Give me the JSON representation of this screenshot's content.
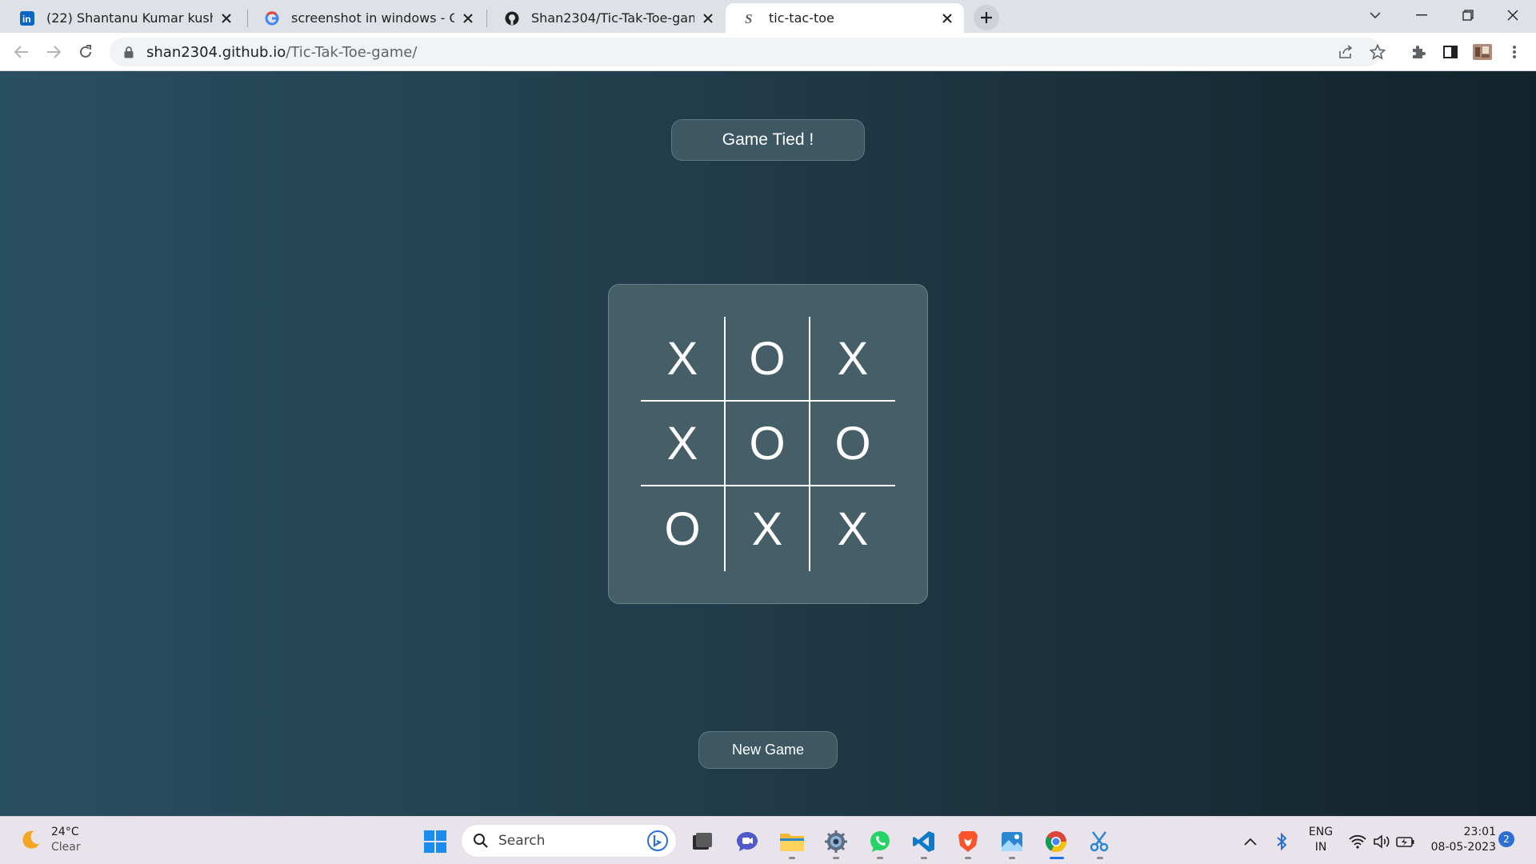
{
  "browser": {
    "tabs": [
      {
        "title": "(22) Shantanu Kumar kushwaha |",
        "icon": "linkedin-icon",
        "active": false
      },
      {
        "title": "screenshot in windows - Google",
        "icon": "google-icon",
        "active": false
      },
      {
        "title": "Shan2304/Tic-Tak-Toe-game: Tic",
        "icon": "github-icon",
        "active": false
      },
      {
        "title": "tic-tac-toe",
        "icon": "site-icon",
        "active": true
      }
    ],
    "url_host": "shan2304.github.io",
    "url_path": "/Tic-Tak-Toe-game/"
  },
  "game": {
    "status": "Game Tied !",
    "board": [
      "X",
      "O",
      "X",
      "X",
      "O",
      "O",
      "O",
      "X",
      "X"
    ],
    "new_game_label": "New Game"
  },
  "taskbar": {
    "weather_temp": "24°C",
    "weather_condition": "Clear",
    "search_placeholder": "Search",
    "lang_line1": "ENG",
    "lang_line2": "IN",
    "time": "23:01",
    "date": "08-05-2023",
    "notification_count": "2"
  },
  "colors": {
    "page_gradient_start": "#2a4e61",
    "page_gradient_end": "#12232b",
    "panel": "#455e67",
    "accent_blue": "#1a73e8"
  }
}
